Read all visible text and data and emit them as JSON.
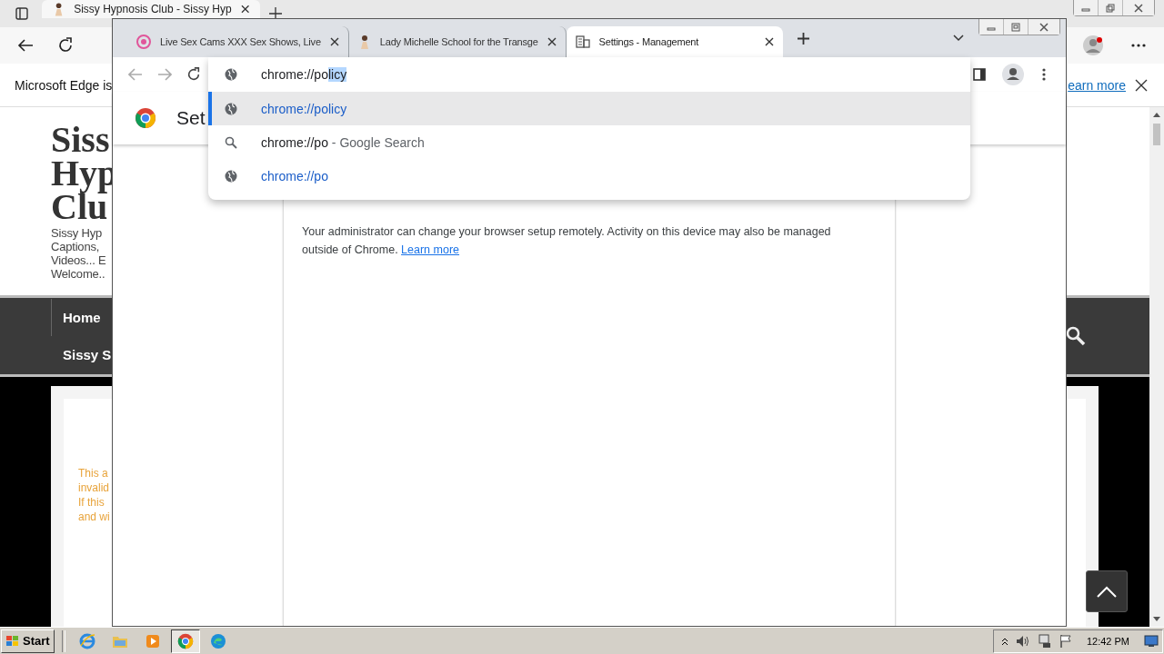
{
  "edge": {
    "tab": {
      "title": "Sissy Hypnosis Club - Sissy Hyp"
    },
    "infobar": {
      "text": "Microsoft Edge is",
      "link": "earn more"
    },
    "site": {
      "title_lines": [
        "Siss",
        "Hyp",
        "Clu"
      ],
      "tagline_lines": [
        "Sissy Hyp",
        "Captions,",
        "Videos... E",
        "Welcome.."
      ],
      "nav": [
        "Home",
        "Sissy S"
      ],
      "notice_lines": [
        "This a",
        "invalid",
        "If this",
        "and wi"
      ]
    }
  },
  "chrome": {
    "tabs": [
      {
        "title": "Live Sex Cams XXX Sex Shows, Live",
        "selected": false
      },
      {
        "title": "Lady Michelle School for the Transge",
        "selected": false
      },
      {
        "title": "Settings - Management",
        "selected": true
      }
    ],
    "omnibox": {
      "typed": "chrome://po",
      "completion": "licy"
    },
    "suggestions": [
      {
        "kind": "url",
        "text": "chrome://policy",
        "selected": true
      },
      {
        "kind": "search",
        "text": "chrome://po",
        "suffix": "- Google Search",
        "selected": false
      },
      {
        "kind": "url",
        "text": "chrome://po",
        "selected": false
      }
    ],
    "page": {
      "header": "Set",
      "notice": "Your administrator can change your browser setup remotely. Activity on this device may also be managed outside of Chrome.",
      "link": "Learn more"
    }
  },
  "taskbar": {
    "start": "Start",
    "clock": "12:42 PM"
  }
}
